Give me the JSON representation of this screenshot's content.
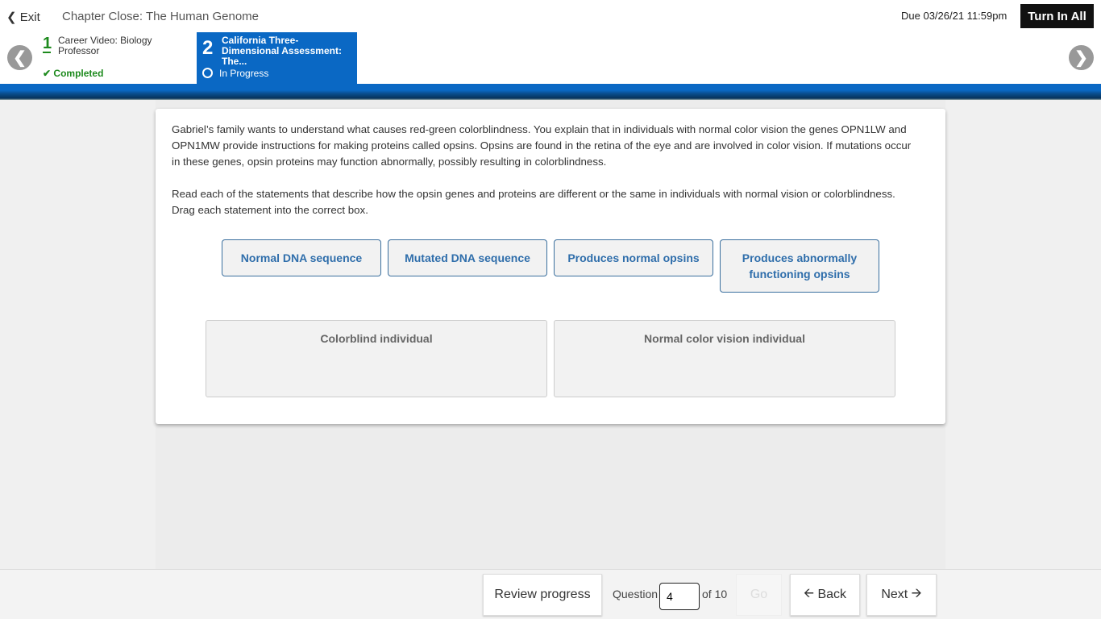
{
  "header": {
    "exit": "Exit",
    "title": "Chapter Close: The Human Genome",
    "due": "Due 03/26/21 11:59pm",
    "turn_in": "Turn In All"
  },
  "steps": [
    {
      "number": "1",
      "label": "Career Video: Biology Professor",
      "status": "Completed"
    },
    {
      "number": "2",
      "label": "California Three-Dimensional Assessment: The...",
      "status": "In Progress"
    }
  ],
  "question": {
    "paragraph1": "Gabriel’s family wants to understand what causes red-green colorblindness. You explain that in individuals with normal color vision the genes OPN1LW and OPN1MW provide instructions for making proteins called opsins. Opsins are found in the retina of the eye and are involved in color vision. If mutations occur in these genes, opsin proteins may function abnormally, possibly resulting in colorblindness.",
    "paragraph2": "Read each of the statements that describe how the opsin genes and proteins are different or the same in individuals with normal vision or colorblindness. Drag each statement into the correct box.",
    "tiles": [
      "Normal DNA sequence",
      "Mutated DNA sequence",
      "Produces normal opsins",
      "Produces abnormally functioning opsins"
    ],
    "zones": [
      "Colorblind individual",
      "Normal color vision individual"
    ]
  },
  "footer": {
    "review": "Review progress",
    "question_label": "Question",
    "question_value": "4",
    "of": "of 10",
    "go": "Go",
    "back": "Back",
    "next": "Next"
  }
}
